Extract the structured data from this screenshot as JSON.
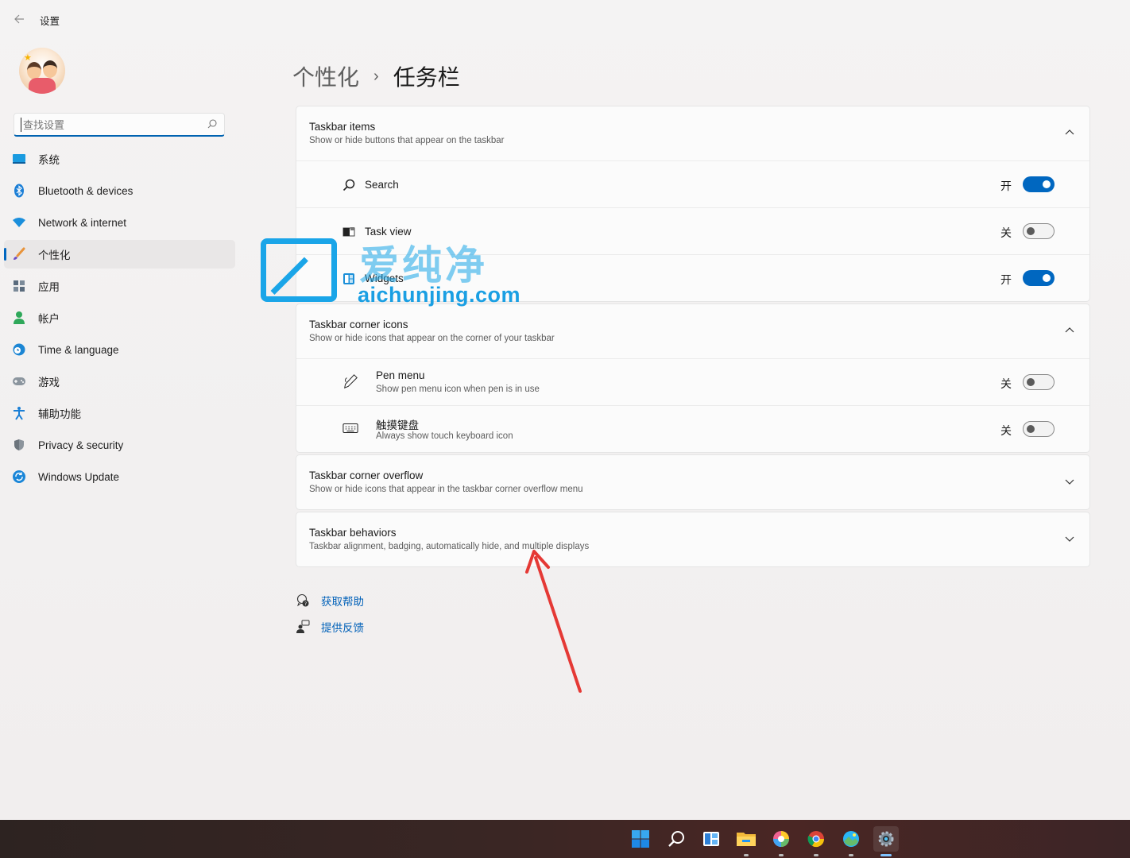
{
  "window": {
    "title": "设置"
  },
  "sidebar": {
    "search_placeholder": "查找设置",
    "items": [
      {
        "label": "系统",
        "icon": "monitor-icon"
      },
      {
        "label": "Bluetooth & devices",
        "icon": "bluetooth-icon"
      },
      {
        "label": "Network & internet",
        "icon": "wifi-icon"
      },
      {
        "label": "个性化",
        "icon": "brush-icon",
        "active": true
      },
      {
        "label": "应用",
        "icon": "apps-icon"
      },
      {
        "label": "帐户",
        "icon": "person-icon"
      },
      {
        "label": "Time & language",
        "icon": "globe-clock-icon"
      },
      {
        "label": "游戏",
        "icon": "gamepad-icon"
      },
      {
        "label": "辅助功能",
        "icon": "accessibility-icon"
      },
      {
        "label": "Privacy & security",
        "icon": "shield-icon"
      },
      {
        "label": "Windows Update",
        "icon": "update-icon"
      }
    ]
  },
  "breadcrumb": {
    "parent": "个性化",
    "separator": "›",
    "current": "任务栏"
  },
  "sections": {
    "taskbar_items": {
      "title": "Taskbar items",
      "subtitle": "Show or hide buttons that appear on the taskbar",
      "expanded": true,
      "rows": [
        {
          "label": "Search",
          "state": "开",
          "on": true
        },
        {
          "label": "Task view",
          "state": "关",
          "on": false
        },
        {
          "label": "Widgets",
          "state": "开",
          "on": true
        }
      ]
    },
    "corner_icons": {
      "title": "Taskbar corner icons",
      "subtitle": "Show or hide icons that appear on the corner of your taskbar",
      "expanded": true,
      "rows": [
        {
          "label": "Pen menu",
          "sub": "Show pen menu icon when pen is in use",
          "state": "关",
          "on": false
        },
        {
          "label": "触摸键盘",
          "sub": "Always show touch keyboard icon",
          "state": "关",
          "on": false
        }
      ]
    },
    "corner_overflow": {
      "title": "Taskbar corner overflow",
      "subtitle": "Show or hide icons that appear in the taskbar corner overflow menu",
      "expanded": false
    },
    "behaviors": {
      "title": "Taskbar behaviors",
      "subtitle": "Taskbar alignment, badging, automatically hide, and multiple displays",
      "expanded": false
    }
  },
  "help_links": {
    "get_help": "获取帮助",
    "feedback": "提供反馈"
  },
  "watermark": {
    "cn": "爱纯净",
    "en": "aichunjing.com"
  },
  "taskbar": {
    "icons": [
      "start-icon",
      "search-icon",
      "widgets-icon",
      "file-explorer-icon",
      "paint-app-icon",
      "chrome-icon",
      "photos-app-icon",
      "settings-icon"
    ],
    "active": "settings-icon"
  },
  "colors": {
    "accent": "#0067c0",
    "annotation_arrow": "#e53935",
    "watermark": "#1aa5e8"
  }
}
